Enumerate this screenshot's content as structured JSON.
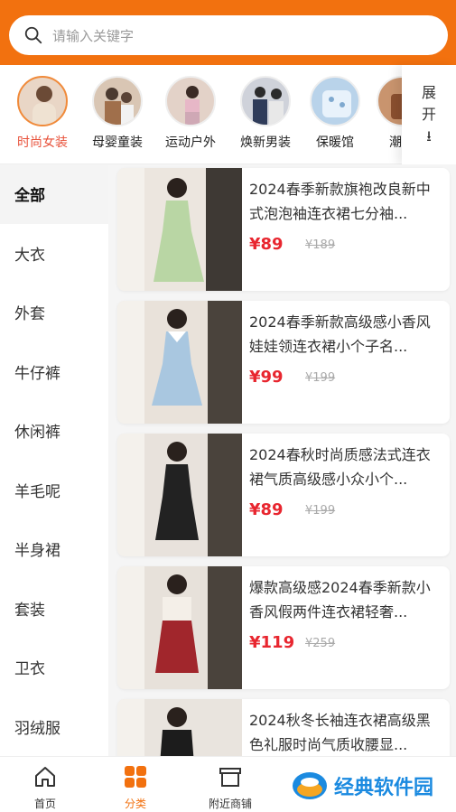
{
  "search": {
    "placeholder": "请输入关键字"
  },
  "categories": [
    {
      "label": "时尚女装",
      "active": true,
      "tone": "#e9d6c6"
    },
    {
      "label": "母婴童装",
      "active": false,
      "tone": "#d9c6b4"
    },
    {
      "label": "运动户外",
      "active": false,
      "tone": "#e3d2c8"
    },
    {
      "label": "焕新男装",
      "active": false,
      "tone": "#cfd2da"
    },
    {
      "label": "保暖馆",
      "active": false,
      "tone": "#b9d3ea"
    },
    {
      "label": "潮搭",
      "active": false,
      "tone": "#c9946e"
    }
  ],
  "expand": {
    "line1": "展",
    "line2": "开",
    "arrow": "⭳"
  },
  "sidebar": {
    "items": [
      {
        "label": "全部"
      },
      {
        "label": "大衣"
      },
      {
        "label": "外套"
      },
      {
        "label": "牛仔裤"
      },
      {
        "label": "休闲裤"
      },
      {
        "label": "羊毛呢"
      },
      {
        "label": "半身裙"
      },
      {
        "label": "套装"
      },
      {
        "label": "卫衣"
      },
      {
        "label": "羽绒服"
      }
    ]
  },
  "products": [
    {
      "title": "2024春季新款旗袍改良新中式泡泡袖连衣裙七分袖...",
      "price": "¥89",
      "orig": "¥189",
      "dress": "#b9d6a4"
    },
    {
      "title": "2024春季新款高级感小香风娃娃领连衣裙小个子名...",
      "price": "¥99",
      "orig": "¥199",
      "dress": "#a9c7e0"
    },
    {
      "title": "2024春秋时尚质感法式连衣裙气质高级感小众小个...",
      "price": "¥89",
      "orig": "¥199",
      "dress": "#222222"
    },
    {
      "title": "爆款高级感2024春季新款小香风假两件连衣裙轻奢...",
      "price": "¥119",
      "orig": "¥259",
      "dress": "#a1262c"
    },
    {
      "title": "2024秋冬长袖连衣裙高级黑色礼服时尚气质收腰显...",
      "price": "",
      "orig": "",
      "dress": "#1c1c1c"
    }
  ],
  "tabs": [
    {
      "label": "首页"
    },
    {
      "label": "分类"
    },
    {
      "label": "附近商铺"
    }
  ],
  "watermark": {
    "text": "经典软件园"
  },
  "colors": {
    "accent": "#f2710f",
    "price": "#e8262f"
  }
}
